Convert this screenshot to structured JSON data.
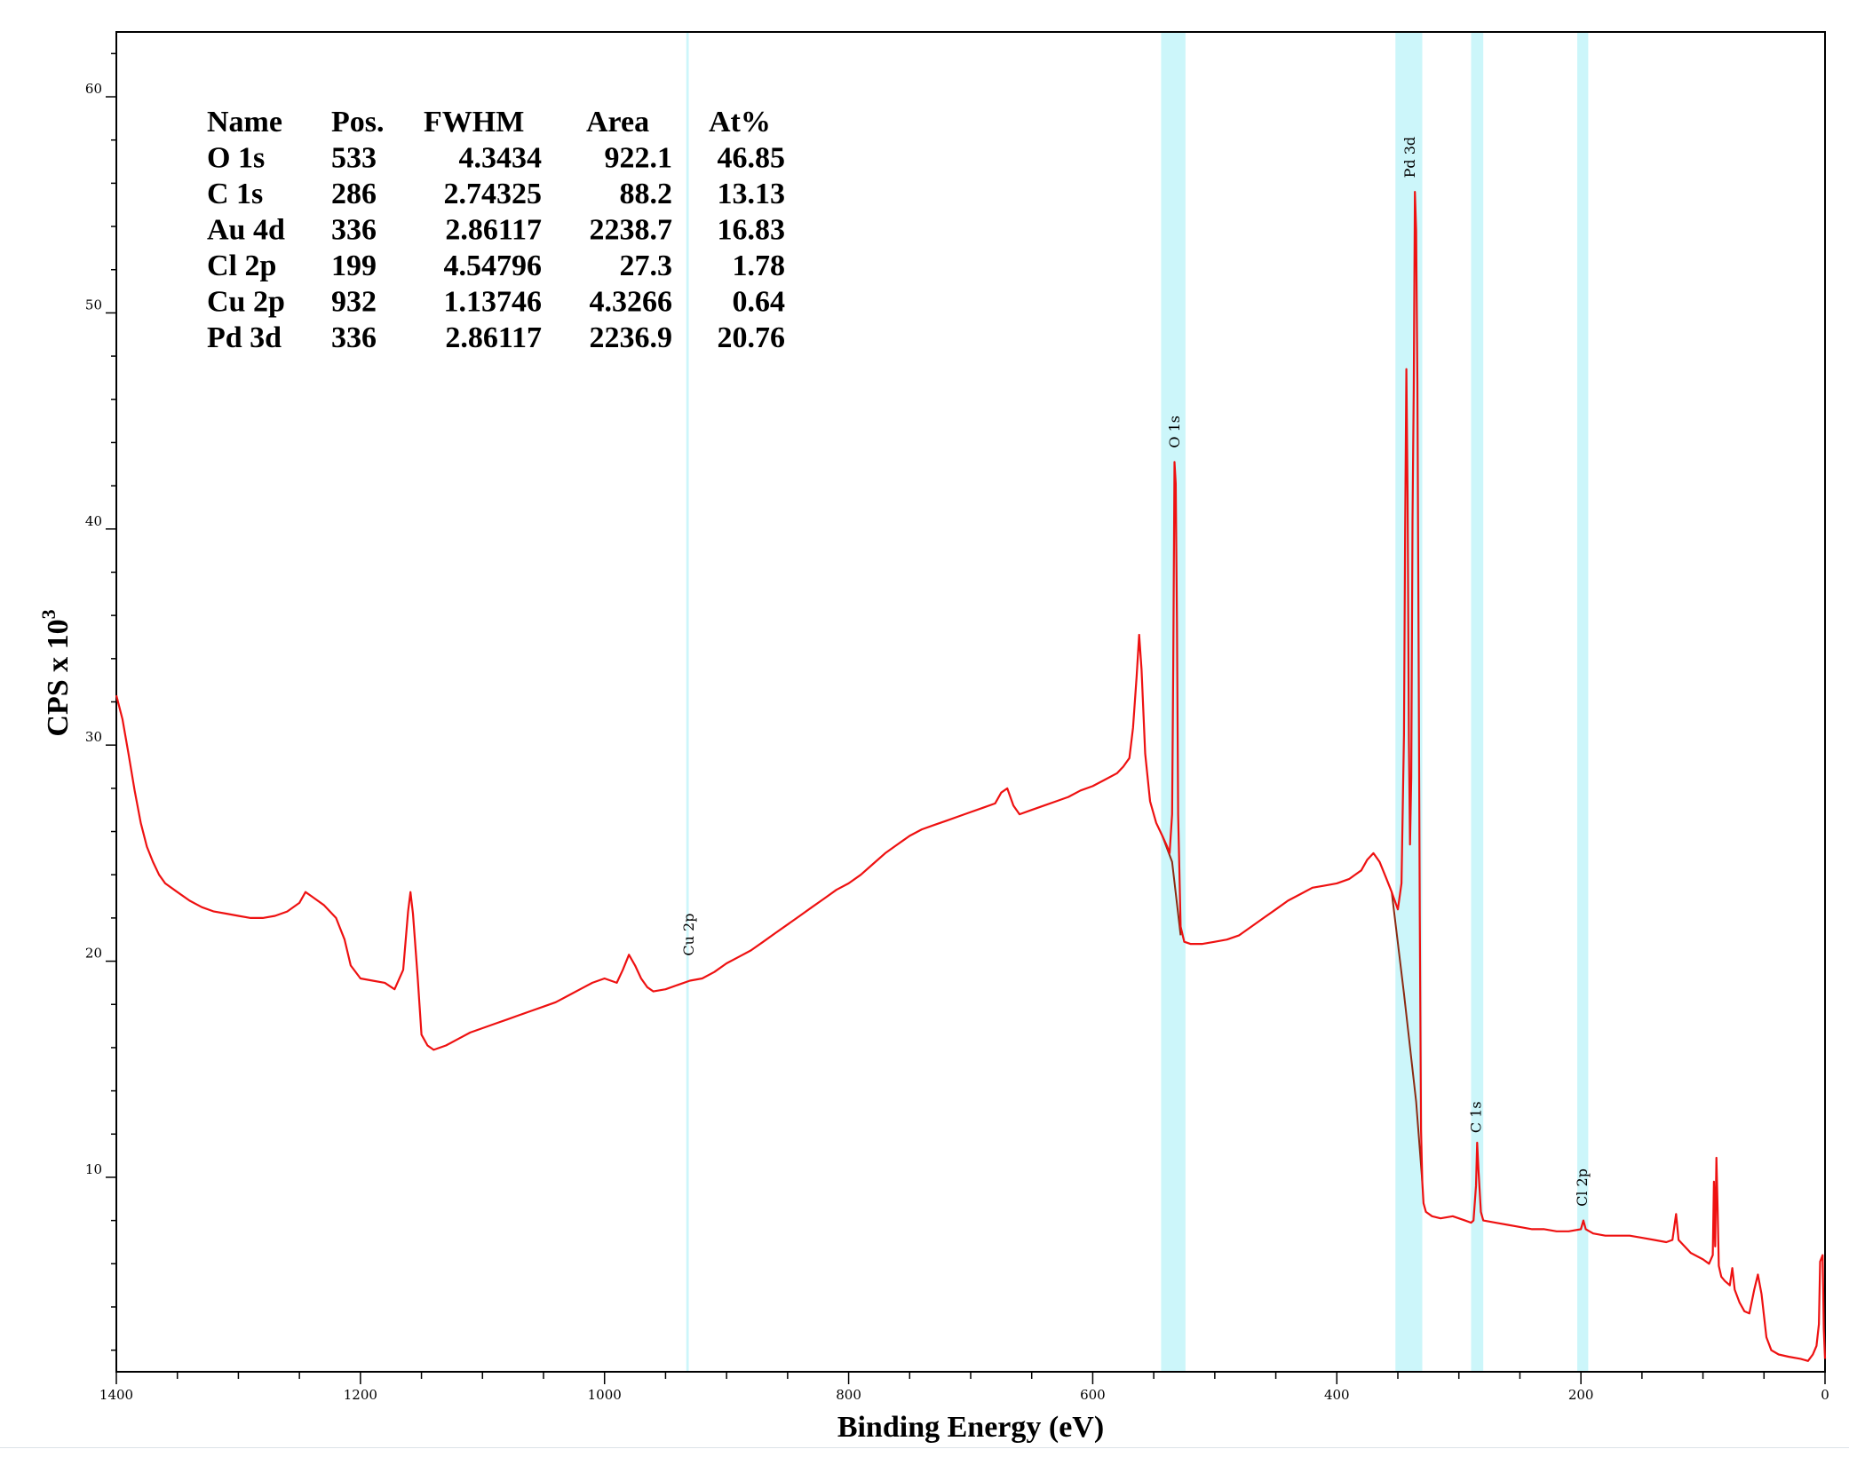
{
  "chart_data": {
    "type": "line",
    "title": "",
    "xlabel": "Binding Energy (eV)",
    "ylabel_main": "CPS x 10",
    "ylabel_exp": "3",
    "xlim": [
      1400,
      0
    ],
    "x_reversed": true,
    "ylim": [
      1,
      63
    ],
    "x_ticks": [
      1400,
      1200,
      1000,
      800,
      600,
      400,
      200,
      0
    ],
    "y_ticks": [
      10,
      20,
      30,
      40,
      50,
      60
    ],
    "grid": false,
    "colors": {
      "spectrum": "#ee1111",
      "baseline": "#8b2a12",
      "region": "#ccf6fa",
      "axis": "#000000"
    },
    "regions": [
      {
        "label": "Cu 2p",
        "x_from": 933,
        "x_to": 931
      },
      {
        "label": "O 1s",
        "x_from": 544,
        "x_to": 524
      },
      {
        "label": "Pd 3d",
        "x_from": 352,
        "x_to": 330
      },
      {
        "label": "C 1s",
        "x_from": 290,
        "x_to": 280
      },
      {
        "label": "Cl 2p",
        "x_from": 203,
        "x_to": 194
      }
    ],
    "peak_labels": [
      {
        "text": "Cu 2p",
        "x": 930,
        "y": 20
      },
      {
        "text": "O 1s",
        "x": 532,
        "y": 43.5
      },
      {
        "text": "Pd 3d",
        "x": 339,
        "y": 56
      },
      {
        "text": "C 1s",
        "x": 285,
        "y": 11.8
      },
      {
        "text": "Cl 2p",
        "x": 198,
        "y": 8.4
      }
    ],
    "series": [
      {
        "points": [
          [
            1400,
            32.3
          ],
          [
            1395,
            31.2
          ],
          [
            1390,
            29.6
          ],
          [
            1385,
            27.9
          ],
          [
            1380,
            26.4
          ],
          [
            1375,
            25.3
          ],
          [
            1370,
            24.6
          ],
          [
            1365,
            24.0
          ],
          [
            1360,
            23.6
          ],
          [
            1350,
            23.2
          ],
          [
            1340,
            22.8
          ],
          [
            1330,
            22.5
          ],
          [
            1320,
            22.3
          ],
          [
            1310,
            22.2
          ],
          [
            1300,
            22.1
          ],
          [
            1290,
            22.0
          ],
          [
            1280,
            22.0
          ],
          [
            1270,
            22.1
          ],
          [
            1260,
            22.3
          ],
          [
            1250,
            22.7
          ],
          [
            1245,
            23.2
          ],
          [
            1240,
            23.0
          ],
          [
            1230,
            22.6
          ],
          [
            1220,
            22.0
          ],
          [
            1213,
            21.0
          ],
          [
            1208,
            19.8
          ],
          [
            1200,
            19.2
          ],
          [
            1190,
            19.1
          ],
          [
            1180,
            19.0
          ],
          [
            1172,
            18.7
          ],
          [
            1165,
            19.6
          ],
          [
            1161,
            22.3
          ],
          [
            1159,
            23.2
          ],
          [
            1157,
            22.2
          ],
          [
            1153,
            19.2
          ],
          [
            1150,
            16.6
          ],
          [
            1145,
            16.1
          ],
          [
            1140,
            15.9
          ],
          [
            1130,
            16.1
          ],
          [
            1120,
            16.4
          ],
          [
            1110,
            16.7
          ],
          [
            1100,
            16.9
          ],
          [
            1090,
            17.1
          ],
          [
            1080,
            17.3
          ],
          [
            1070,
            17.5
          ],
          [
            1060,
            17.7
          ],
          [
            1050,
            17.9
          ],
          [
            1040,
            18.1
          ],
          [
            1030,
            18.4
          ],
          [
            1020,
            18.7
          ],
          [
            1010,
            19.0
          ],
          [
            1000,
            19.2
          ],
          [
            990,
            19.0
          ],
          [
            985,
            19.6
          ],
          [
            980,
            20.3
          ],
          [
            975,
            19.8
          ],
          [
            970,
            19.2
          ],
          [
            965,
            18.8
          ],
          [
            960,
            18.6
          ],
          [
            950,
            18.7
          ],
          [
            940,
            18.9
          ],
          [
            930,
            19.1
          ],
          [
            920,
            19.2
          ],
          [
            910,
            19.5
          ],
          [
            900,
            19.9
          ],
          [
            890,
            20.2
          ],
          [
            880,
            20.5
          ],
          [
            870,
            20.9
          ],
          [
            860,
            21.3
          ],
          [
            850,
            21.7
          ],
          [
            840,
            22.1
          ],
          [
            830,
            22.5
          ],
          [
            820,
            22.9
          ],
          [
            810,
            23.3
          ],
          [
            800,
            23.6
          ],
          [
            790,
            24.0
          ],
          [
            780,
            24.5
          ],
          [
            770,
            25.0
          ],
          [
            760,
            25.4
          ],
          [
            750,
            25.8
          ],
          [
            740,
            26.1
          ],
          [
            730,
            26.3
          ],
          [
            720,
            26.5
          ],
          [
            710,
            26.7
          ],
          [
            700,
            26.9
          ],
          [
            690,
            27.1
          ],
          [
            680,
            27.3
          ],
          [
            675,
            27.8
          ],
          [
            670,
            28.0
          ],
          [
            665,
            27.2
          ],
          [
            660,
            26.8
          ],
          [
            650,
            27.0
          ],
          [
            640,
            27.2
          ],
          [
            630,
            27.4
          ],
          [
            620,
            27.6
          ],
          [
            610,
            27.9
          ],
          [
            600,
            28.1
          ],
          [
            590,
            28.4
          ],
          [
            580,
            28.7
          ],
          [
            575,
            29.0
          ],
          [
            570,
            29.4
          ],
          [
            567,
            30.8
          ],
          [
            564,
            33.2
          ],
          [
            562,
            35.1
          ],
          [
            560,
            33.5
          ],
          [
            557,
            29.6
          ],
          [
            553,
            27.4
          ],
          [
            548,
            26.4
          ],
          [
            543,
            25.8
          ],
          [
            539,
            25.3
          ],
          [
            537,
            25.0
          ],
          [
            535,
            26.8
          ],
          [
            534,
            33.7
          ],
          [
            533,
            43.1
          ],
          [
            532,
            42.1
          ],
          [
            531,
            35.6
          ],
          [
            530,
            26.8
          ],
          [
            528,
            21.6
          ],
          [
            525,
            20.9
          ],
          [
            520,
            20.8
          ],
          [
            510,
            20.8
          ],
          [
            500,
            20.9
          ],
          [
            490,
            21.0
          ],
          [
            480,
            21.2
          ],
          [
            470,
            21.6
          ],
          [
            460,
            22.0
          ],
          [
            450,
            22.4
          ],
          [
            440,
            22.8
          ],
          [
            430,
            23.1
          ],
          [
            420,
            23.4
          ],
          [
            410,
            23.5
          ],
          [
            400,
            23.6
          ],
          [
            390,
            23.8
          ],
          [
            380,
            24.2
          ],
          [
            375,
            24.7
          ],
          [
            370,
            25.0
          ],
          [
            365,
            24.6
          ],
          [
            360,
            23.9
          ],
          [
            355,
            23.2
          ],
          [
            350,
            22.4
          ],
          [
            347,
            23.6
          ],
          [
            345,
            30.5
          ],
          [
            344,
            39.9
          ],
          [
            343,
            47.4
          ],
          [
            342,
            41.5
          ],
          [
            341,
            30.3
          ],
          [
            340,
            25.4
          ],
          [
            339,
            28.5
          ],
          [
            338,
            40.4
          ],
          [
            337,
            46.5
          ],
          [
            336,
            55.6
          ],
          [
            335,
            53.8
          ],
          [
            334,
            46.8
          ],
          [
            333,
            34.2
          ],
          [
            332,
            22.1
          ],
          [
            331,
            12.2
          ],
          [
            330,
            9.8
          ],
          [
            329,
            8.8
          ],
          [
            327,
            8.4
          ],
          [
            322,
            8.2
          ],
          [
            315,
            8.1
          ],
          [
            305,
            8.2
          ],
          [
            295,
            8.0
          ],
          [
            290,
            7.9
          ],
          [
            288,
            8.0
          ],
          [
            286,
            9.6
          ],
          [
            285,
            11.6
          ],
          [
            284,
            10.4
          ],
          [
            282,
            8.4
          ],
          [
            280,
            8.0
          ],
          [
            270,
            7.9
          ],
          [
            260,
            7.8
          ],
          [
            250,
            7.7
          ],
          [
            240,
            7.6
          ],
          [
            230,
            7.6
          ],
          [
            220,
            7.5
          ],
          [
            210,
            7.5
          ],
          [
            200,
            7.6
          ],
          [
            198,
            8.0
          ],
          [
            196,
            7.6
          ],
          [
            190,
            7.4
          ],
          [
            180,
            7.3
          ],
          [
            170,
            7.3
          ],
          [
            160,
            7.3
          ],
          [
            150,
            7.2
          ],
          [
            140,
            7.1
          ],
          [
            130,
            7.0
          ],
          [
            125,
            7.1
          ],
          [
            122,
            8.3
          ],
          [
            120,
            7.1
          ],
          [
            110,
            6.5
          ],
          [
            100,
            6.2
          ],
          [
            95,
            6.0
          ],
          [
            92,
            6.4
          ],
          [
            91,
            9.8
          ],
          [
            90,
            6.8
          ],
          [
            89,
            10.9
          ],
          [
            88,
            8.5
          ],
          [
            87,
            5.9
          ],
          [
            85,
            5.4
          ],
          [
            82,
            5.2
          ],
          [
            78,
            5.0
          ],
          [
            76,
            5.8
          ],
          [
            74,
            4.8
          ],
          [
            70,
            4.2
          ],
          [
            66,
            3.8
          ],
          [
            62,
            3.7
          ],
          [
            58,
            4.8
          ],
          [
            55,
            5.5
          ],
          [
            52,
            4.6
          ],
          [
            48,
            2.6
          ],
          [
            44,
            2.0
          ],
          [
            38,
            1.8
          ],
          [
            30,
            1.7
          ],
          [
            20,
            1.6
          ],
          [
            14,
            1.5
          ],
          [
            10,
            1.8
          ],
          [
            7,
            2.2
          ],
          [
            5,
            3.2
          ],
          [
            4,
            6.1
          ],
          [
            2,
            6.4
          ],
          [
            1,
            3.0
          ],
          [
            0,
            1.6
          ]
        ]
      }
    ],
    "baseline_segments": [
      [
        [
          543,
          25.8
        ],
        [
          535,
          24.6
        ],
        [
          528,
          21.2
        ]
      ],
      [
        [
          355,
          23.2
        ],
        [
          345,
          18.5
        ],
        [
          335,
          13.5
        ],
        [
          330,
          9.8
        ]
      ]
    ],
    "table": {
      "header": [
        "Name",
        "Pos.",
        "FWHM",
        "Area",
        "At%"
      ],
      "rows": [
        [
          "O 1s",
          "533",
          "4.3434",
          "922.1",
          "46.85"
        ],
        [
          "C 1s",
          "286",
          "2.74325",
          "88.2",
          "13.13"
        ],
        [
          "Au 4d",
          "336",
          "2.86117",
          "2238.7",
          "16.83"
        ],
        [
          "Cl 2p",
          "199",
          "4.54796",
          "27.3",
          "1.78"
        ],
        [
          "Cu 2p",
          "932",
          "1.13746",
          "4.3266",
          "0.64"
        ],
        [
          "Pd 3d",
          "336",
          "2.86117",
          "2236.9",
          "20.76"
        ]
      ]
    }
  }
}
